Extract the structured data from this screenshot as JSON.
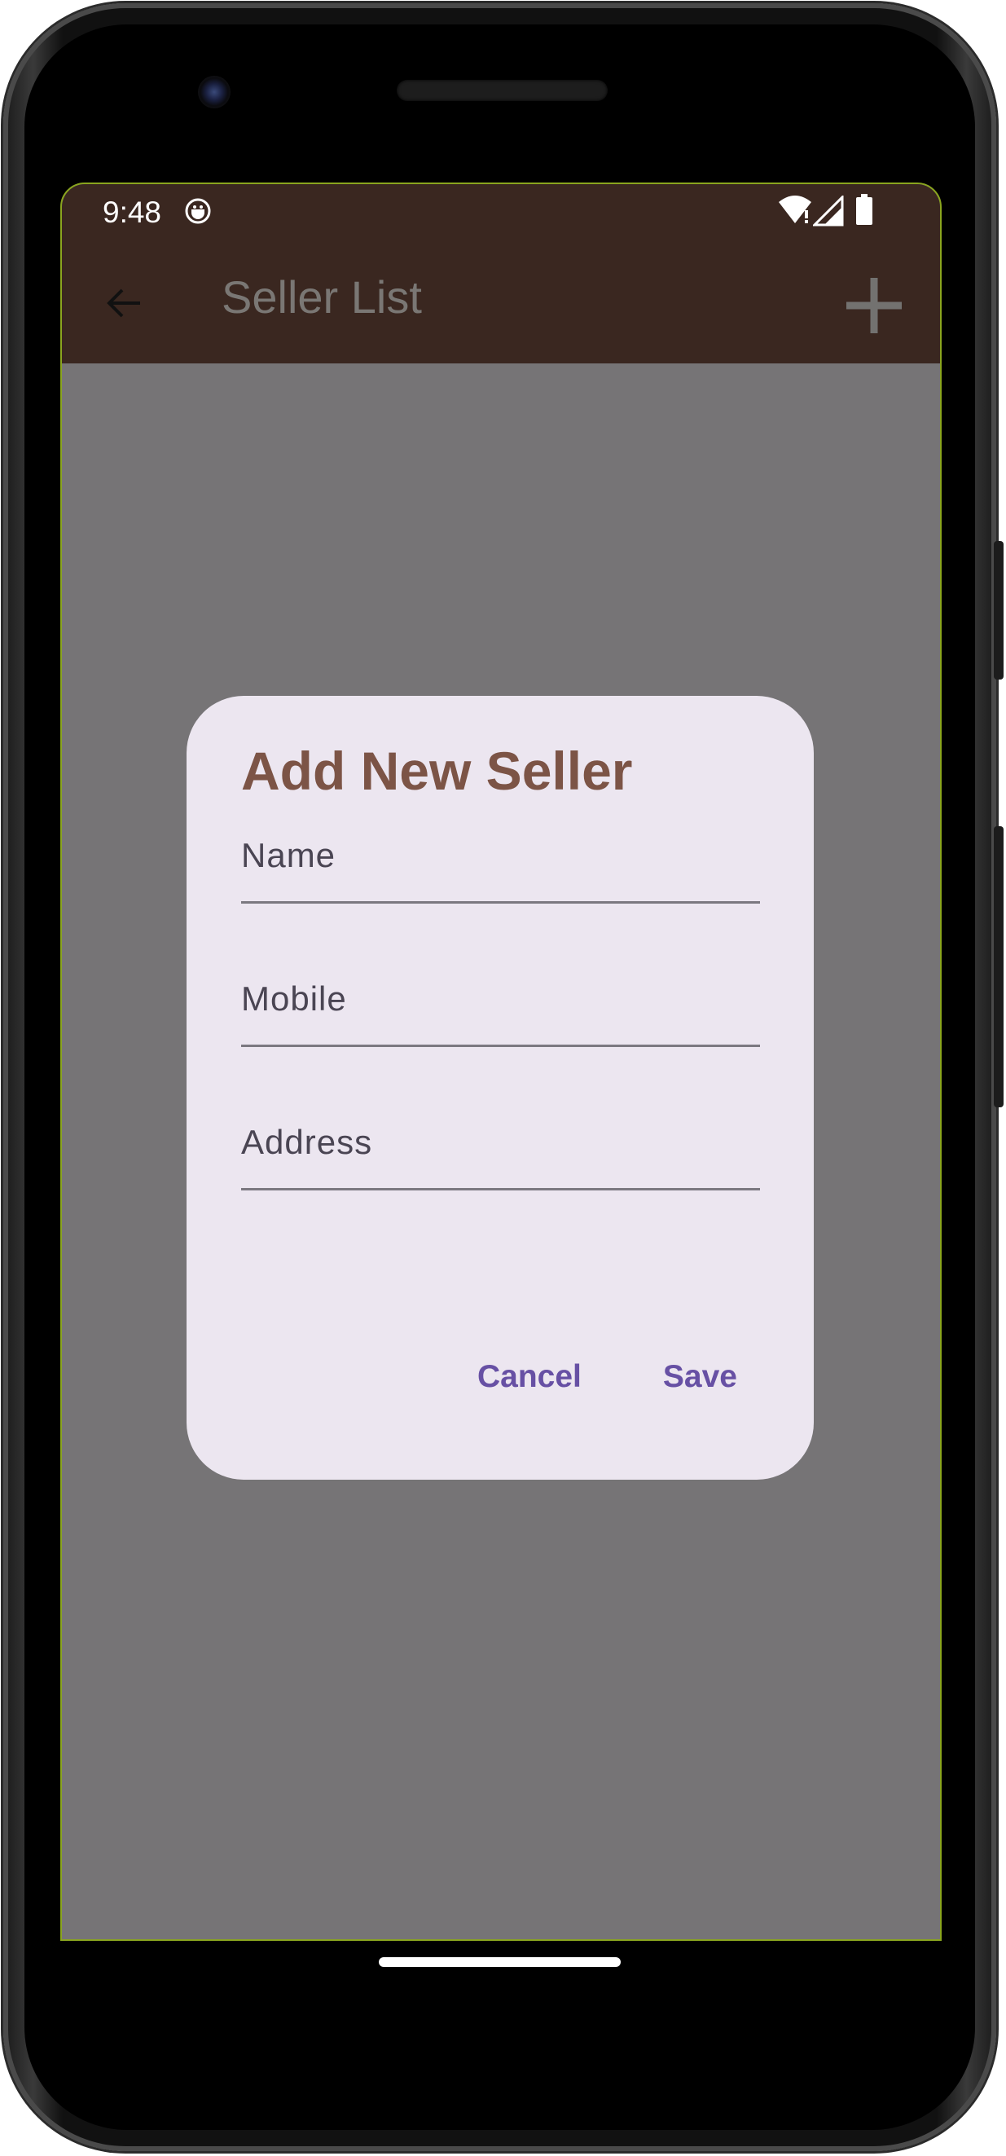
{
  "status_bar": {
    "time": "9:48",
    "icons": [
      "app-notification-icon",
      "wifi-icon",
      "signal-icon",
      "battery-icon"
    ]
  },
  "app_bar": {
    "title": "Seller List",
    "back_icon": "arrow-back-icon",
    "action_icon": "add-icon",
    "background_color": "#3a2720"
  },
  "dialog": {
    "title": "Add New Seller",
    "fields": [
      {
        "label": "Name",
        "value": ""
      },
      {
        "label": "Mobile",
        "value": ""
      },
      {
        "label": "Address",
        "value": ""
      }
    ],
    "actions": {
      "cancel_label": "Cancel",
      "save_label": "Save"
    },
    "accent_color": "#6750a4",
    "title_color": "#7c5446"
  }
}
